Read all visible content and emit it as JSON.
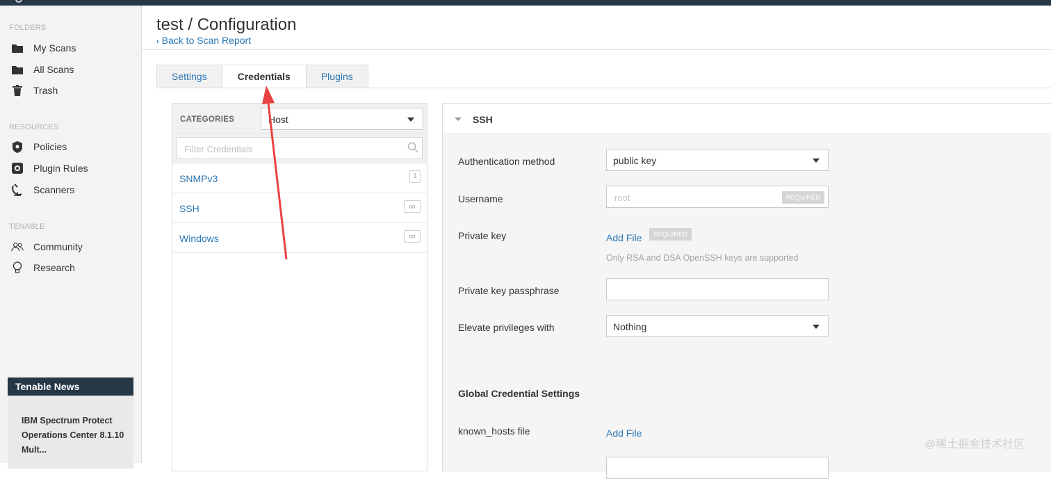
{
  "topbar": {
    "brand": "essentials"
  },
  "sidebar": {
    "sections": [
      {
        "label": "FOLDERS",
        "items": [
          {
            "label": "My Scans",
            "icon": "folder-icon"
          },
          {
            "label": "All Scans",
            "icon": "folder-icon"
          },
          {
            "label": "Trash",
            "icon": "trash-icon"
          }
        ]
      },
      {
        "label": "RESOURCES",
        "items": [
          {
            "label": "Policies",
            "icon": "shield-icon"
          },
          {
            "label": "Plugin Rules",
            "icon": "plugin-icon"
          },
          {
            "label": "Scanners",
            "icon": "satellite-icon"
          }
        ]
      },
      {
        "label": "TENABLE",
        "items": [
          {
            "label": "Community",
            "icon": "people-icon"
          },
          {
            "label": "Research",
            "icon": "lightbulb-icon"
          }
        ]
      }
    ],
    "news": {
      "title": "Tenable News",
      "headline": "IBM Spectrum Protect Operations Center 8.1.10 Mult..."
    }
  },
  "header": {
    "title": "test / Configuration",
    "back_link": "Back to Scan Report"
  },
  "tabs": [
    {
      "label": "Settings",
      "active": false
    },
    {
      "label": "Credentials",
      "active": true
    },
    {
      "label": "Plugins",
      "active": false
    }
  ],
  "categories": {
    "label": "CATEGORIES",
    "selected": "Host",
    "filter_placeholder": "Filter Credentials",
    "items": [
      {
        "name": "SNMPv3",
        "count": "1"
      },
      {
        "name": "SSH",
        "count": "∞"
      },
      {
        "name": "Windows",
        "count": "∞"
      }
    ]
  },
  "ssh": {
    "title": "SSH",
    "auth_method_label": "Authentication method",
    "auth_method_value": "public key",
    "username_label": "Username",
    "username_placeholder": "root",
    "required_badge": "REQUIRED",
    "private_key_label": "Private key",
    "add_file": "Add File",
    "private_key_hint": "Only RSA and DSA OpenSSH keys are supported",
    "passphrase_label": "Private key passphrase",
    "elevate_label": "Elevate privileges with",
    "elevate_value": "Nothing",
    "global_heading": "Global Credential Settings",
    "known_hosts_label": "known_hosts file"
  },
  "watermark": "@稀土掘金技术社区",
  "colors": {
    "link": "#2b77b5",
    "navy": "#263746",
    "annotation_arrow": "#e8423f"
  }
}
